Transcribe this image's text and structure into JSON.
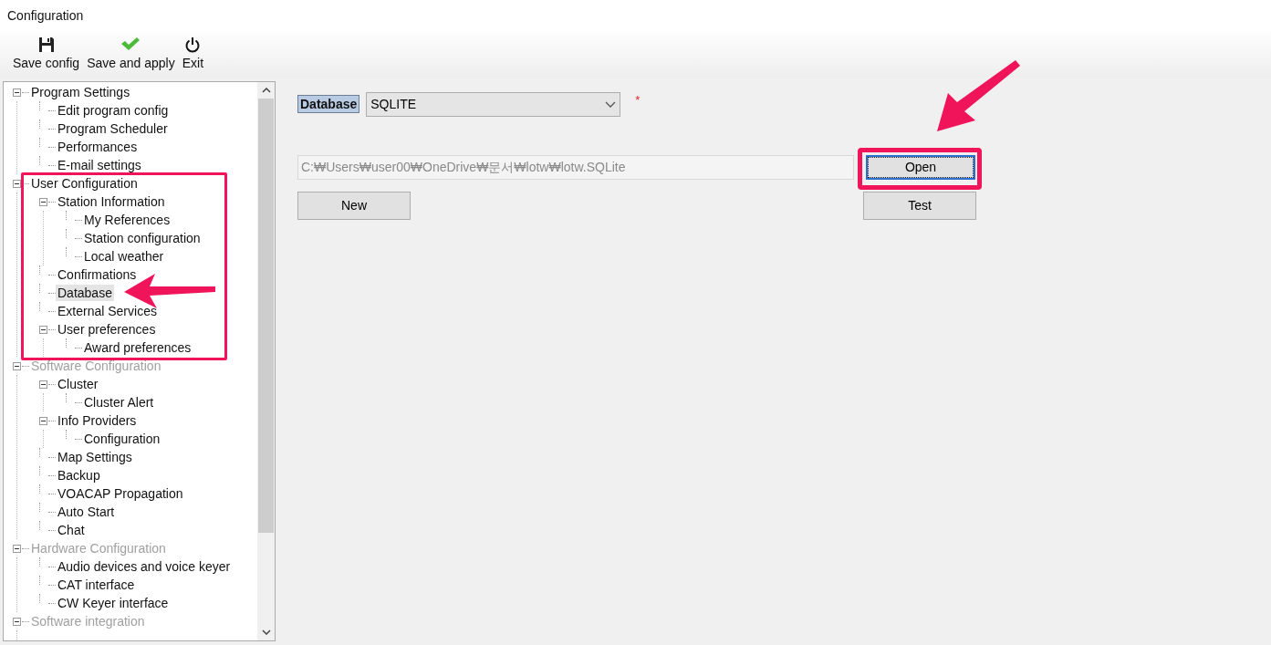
{
  "window": {
    "title": "Configuration"
  },
  "toolbar": [
    {
      "kind": "save",
      "label": "Save config"
    },
    {
      "kind": "apply",
      "label": "Save and apply"
    },
    {
      "kind": "exit",
      "label": "Exit"
    }
  ],
  "tree": [
    {
      "label": "Program Settings",
      "disabled": false,
      "expanded": true,
      "selected": false,
      "children": [
        {
          "label": "Edit program config",
          "disabled": false,
          "selected": false
        },
        {
          "label": "Program Scheduler",
          "disabled": false,
          "selected": false
        },
        {
          "label": "Performances",
          "disabled": false,
          "selected": false
        },
        {
          "label": "E-mail settings",
          "disabled": false,
          "selected": false
        }
      ]
    },
    {
      "label": "User Configuration",
      "disabled": false,
      "expanded": true,
      "selected": false,
      "children": [
        {
          "label": "Station Information",
          "disabled": false,
          "expanded": true,
          "selected": false,
          "children": [
            {
              "label": "My References",
              "disabled": false,
              "selected": false
            },
            {
              "label": "Station configuration",
              "disabled": false,
              "selected": false
            },
            {
              "label": "Local weather",
              "disabled": false,
              "selected": false
            }
          ]
        },
        {
          "label": "Confirmations",
          "disabled": false,
          "selected": false
        },
        {
          "label": "Database",
          "disabled": false,
          "selected": true
        },
        {
          "label": "External Services",
          "disabled": false,
          "selected": false
        },
        {
          "label": "User preferences",
          "disabled": false,
          "expanded": true,
          "selected": false,
          "children": [
            {
              "label": "Award preferences",
              "disabled": false,
              "selected": false
            }
          ]
        }
      ]
    },
    {
      "label": "Software Configuration",
      "disabled": true,
      "expanded": true,
      "selected": false,
      "children": [
        {
          "label": "Cluster",
          "disabled": false,
          "expanded": true,
          "selected": false,
          "children": [
            {
              "label": "Cluster Alert",
              "disabled": false,
              "selected": false
            }
          ]
        },
        {
          "label": "Info Providers",
          "disabled": false,
          "expanded": true,
          "selected": false,
          "children": [
            {
              "label": "Configuration",
              "disabled": false,
              "selected": false
            }
          ]
        },
        {
          "label": "Map Settings",
          "disabled": false,
          "selected": false
        },
        {
          "label": "Backup",
          "disabled": false,
          "selected": false
        },
        {
          "label": "VOACAP Propagation",
          "disabled": false,
          "selected": false
        },
        {
          "label": "Auto Start",
          "disabled": false,
          "selected": false
        },
        {
          "label": "Chat",
          "disabled": false,
          "selected": false
        }
      ]
    },
    {
      "label": "Hardware Configuration",
      "disabled": true,
      "expanded": true,
      "selected": false,
      "children": [
        {
          "label": "Audio devices and voice keyer",
          "disabled": false,
          "selected": false
        },
        {
          "label": "CAT interface",
          "disabled": false,
          "selected": false
        },
        {
          "label": "CW Keyer interface",
          "disabled": false,
          "selected": false
        }
      ]
    },
    {
      "label": "Software integration",
      "disabled": true,
      "expanded": true,
      "selected": false
    }
  ],
  "database": {
    "label": "Database",
    "type": "SQLITE",
    "required_mark": "*",
    "path": "C:₩Users₩user00₩OneDrive₩문서₩lotw₩lotw.SQLite",
    "buttons": {
      "new": "New",
      "open": "Open",
      "test": "Test"
    }
  }
}
